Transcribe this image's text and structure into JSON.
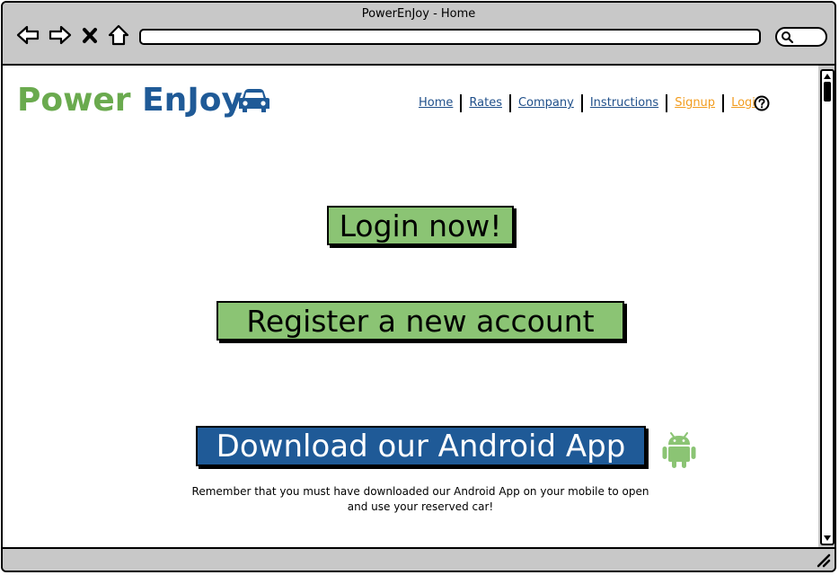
{
  "window": {
    "title": "PowerEnJoy - Home",
    "address_bar_value": ""
  },
  "browser_controls": {
    "back": "back-arrow-icon",
    "forward": "forward-arrow-icon",
    "stop": "close-icon",
    "home": "home-icon",
    "search": "search-icon"
  },
  "brand": {
    "part1": "Power",
    "part2": "EnJoy",
    "icon": "car-icon",
    "colors": {
      "green": "#6aaa4e",
      "blue": "#1f5a97"
    }
  },
  "nav": {
    "items": [
      {
        "label": "Home",
        "color": "#1f4f8a"
      },
      {
        "label": "Rates",
        "color": "#1f4f8a"
      },
      {
        "label": "Company",
        "color": "#1f4f8a"
      },
      {
        "label": "Instructions",
        "color": "#1f4f8a"
      },
      {
        "label": "Signup",
        "color": "#f29c1e"
      },
      {
        "label": "Login",
        "color": "#f29c1e"
      }
    ],
    "help_icon": "help-icon"
  },
  "main": {
    "login_button": "Login now!",
    "register_button": "Register a new account",
    "download_button": "Download our Android App",
    "android_icon": "android-icon",
    "note_line1": "Remember that you must have downloaded our Android App on your mobile to open",
    "note_line2": "and use your reserved car!"
  },
  "colors": {
    "button_green": "#8bc474",
    "button_blue": "#1f5a97",
    "android_green": "#8bc474"
  }
}
